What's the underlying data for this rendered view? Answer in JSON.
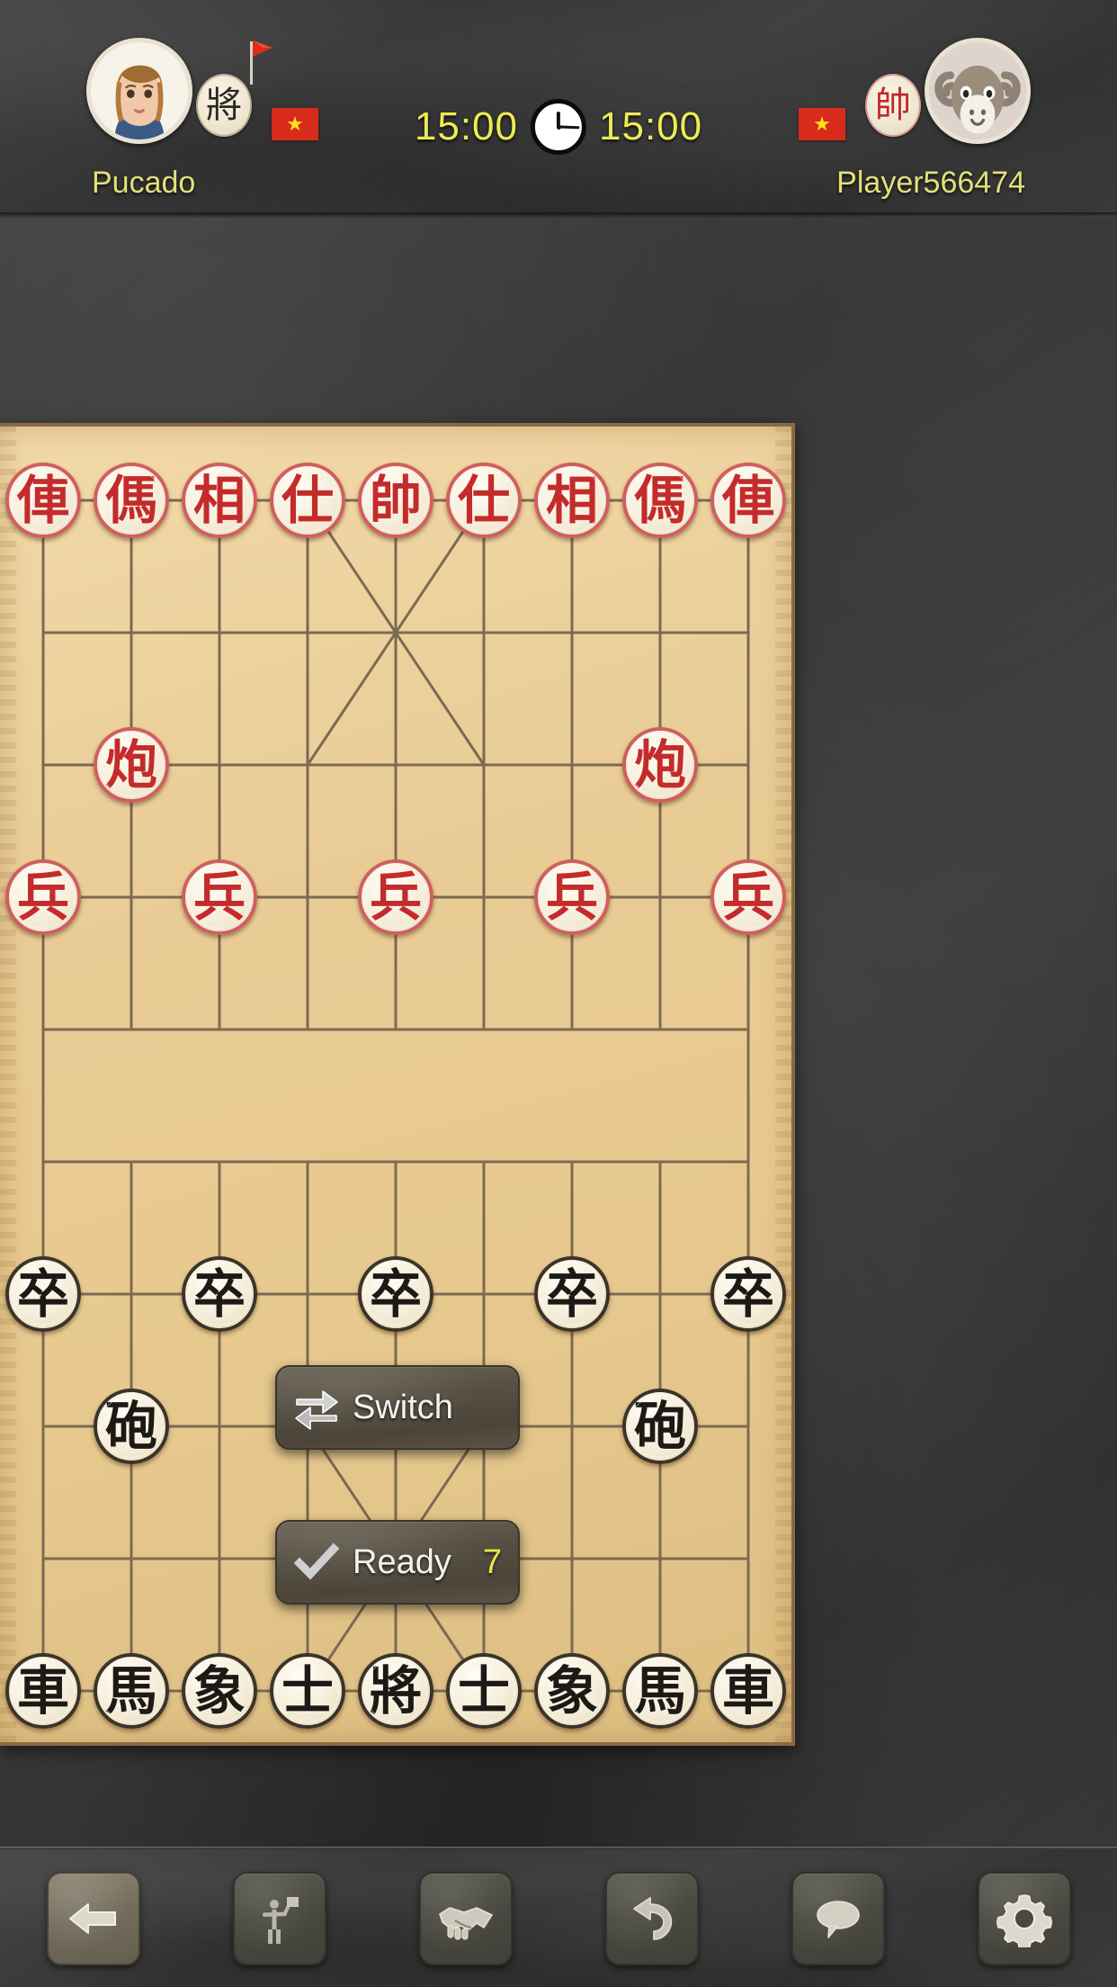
{
  "top_bar": {
    "left_player": {
      "name": "Pucado",
      "avatar_icon": "female-avatar-icon",
      "flag_icon": "red-flag-icon",
      "side_token": "將",
      "side": "black",
      "country_flag_icon": "vietnam-flag-icon",
      "country_star": "★"
    },
    "right_player": {
      "name": "Player566474",
      "avatar_icon": "ram-avatar-icon",
      "side_token": "帥",
      "side": "red",
      "country_flag_icon": "vietnam-flag-icon",
      "country_star": "★"
    },
    "clock": {
      "left_time": "15:00",
      "right_time": "15:00",
      "icon": "analog-clock-icon"
    }
  },
  "board": {
    "columns": 9,
    "rows": 10,
    "pieces": [
      {
        "glyph": "俥",
        "side": "red",
        "col": 0,
        "row": 0,
        "name": "red-chariot-left"
      },
      {
        "glyph": "傌",
        "side": "red",
        "col": 1,
        "row": 0,
        "name": "red-horse-left"
      },
      {
        "glyph": "相",
        "side": "red",
        "col": 2,
        "row": 0,
        "name": "red-elephant-left"
      },
      {
        "glyph": "仕",
        "side": "red",
        "col": 3,
        "row": 0,
        "name": "red-advisor-left"
      },
      {
        "glyph": "帥",
        "side": "red",
        "col": 4,
        "row": 0,
        "name": "red-general"
      },
      {
        "glyph": "仕",
        "side": "red",
        "col": 5,
        "row": 0,
        "name": "red-advisor-right"
      },
      {
        "glyph": "相",
        "side": "red",
        "col": 6,
        "row": 0,
        "name": "red-elephant-right"
      },
      {
        "glyph": "傌",
        "side": "red",
        "col": 7,
        "row": 0,
        "name": "red-horse-right"
      },
      {
        "glyph": "俥",
        "side": "red",
        "col": 8,
        "row": 0,
        "name": "red-chariot-right"
      },
      {
        "glyph": "炮",
        "side": "red",
        "col": 1,
        "row": 2,
        "name": "red-cannon-left"
      },
      {
        "glyph": "炮",
        "side": "red",
        "col": 7,
        "row": 2,
        "name": "red-cannon-right"
      },
      {
        "glyph": "兵",
        "side": "red",
        "col": 0,
        "row": 3,
        "name": "red-soldier-1"
      },
      {
        "glyph": "兵",
        "side": "red",
        "col": 2,
        "row": 3,
        "name": "red-soldier-2"
      },
      {
        "glyph": "兵",
        "side": "red",
        "col": 4,
        "row": 3,
        "name": "red-soldier-3"
      },
      {
        "glyph": "兵",
        "side": "red",
        "col": 6,
        "row": 3,
        "name": "red-soldier-4"
      },
      {
        "glyph": "兵",
        "side": "red",
        "col": 8,
        "row": 3,
        "name": "red-soldier-5"
      },
      {
        "glyph": "卒",
        "side": "black",
        "col": 0,
        "row": 6,
        "name": "black-soldier-1"
      },
      {
        "glyph": "卒",
        "side": "black",
        "col": 2,
        "row": 6,
        "name": "black-soldier-2"
      },
      {
        "glyph": "卒",
        "side": "black",
        "col": 4,
        "row": 6,
        "name": "black-soldier-3"
      },
      {
        "glyph": "卒",
        "side": "black",
        "col": 6,
        "row": 6,
        "name": "black-soldier-4"
      },
      {
        "glyph": "卒",
        "side": "black",
        "col": 8,
        "row": 6,
        "name": "black-soldier-5"
      },
      {
        "glyph": "砲",
        "side": "black",
        "col": 1,
        "row": 7,
        "name": "black-cannon-left"
      },
      {
        "glyph": "砲",
        "side": "black",
        "col": 7,
        "row": 7,
        "name": "black-cannon-right"
      },
      {
        "glyph": "車",
        "side": "black",
        "col": 0,
        "row": 9,
        "name": "black-chariot-left"
      },
      {
        "glyph": "馬",
        "side": "black",
        "col": 1,
        "row": 9,
        "name": "black-horse-left"
      },
      {
        "glyph": "象",
        "side": "black",
        "col": 2,
        "row": 9,
        "name": "black-elephant-left"
      },
      {
        "glyph": "士",
        "side": "black",
        "col": 3,
        "row": 9,
        "name": "black-advisor-left"
      },
      {
        "glyph": "將",
        "side": "black",
        "col": 4,
        "row": 9,
        "name": "black-general"
      },
      {
        "glyph": "士",
        "side": "black",
        "col": 5,
        "row": 9,
        "name": "black-advisor-right"
      },
      {
        "glyph": "象",
        "side": "black",
        "col": 6,
        "row": 9,
        "name": "black-elephant-right"
      },
      {
        "glyph": "馬",
        "side": "black",
        "col": 7,
        "row": 9,
        "name": "black-horse-right"
      },
      {
        "glyph": "車",
        "side": "black",
        "col": 8,
        "row": 9,
        "name": "black-chariot-right"
      }
    ]
  },
  "overlay_buttons": {
    "switch": {
      "label": "Switch",
      "icon": "swap-arrows-icon"
    },
    "ready": {
      "label": "Ready",
      "icon": "check-icon",
      "countdown": "7"
    }
  },
  "toolbar": [
    {
      "name": "back-button",
      "icon": "left-arrow-icon",
      "primary": true
    },
    {
      "name": "resign-button",
      "icon": "surrender-flag-icon",
      "primary": false
    },
    {
      "name": "draw-button",
      "icon": "handshake-icon",
      "primary": false
    },
    {
      "name": "undo-button",
      "icon": "undo-arrow-icon",
      "primary": false
    },
    {
      "name": "chat-button",
      "icon": "speech-bubble-icon",
      "primary": false
    },
    {
      "name": "settings-button",
      "icon": "gear-icon",
      "primary": false
    }
  ],
  "colors": {
    "board_wood": "#e9cc95",
    "red_piece": "#c42b2b",
    "black_piece": "#1d1a15",
    "name_text": "#e3e07a",
    "clock_text": "#edea55",
    "countdown": "#ece64e",
    "flag_red": "#d92b1c"
  }
}
